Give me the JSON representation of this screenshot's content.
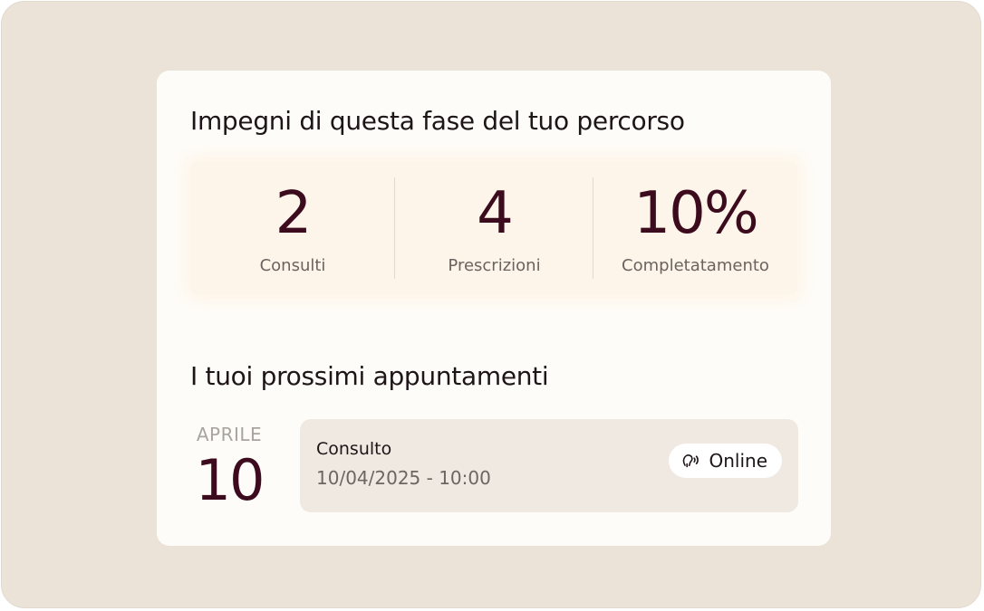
{
  "commitments": {
    "title": "Impegni di questa fase del tuo percorso",
    "stats": [
      {
        "value": "2",
        "label": "Consulti"
      },
      {
        "value": "4",
        "label": "Prescrizioni"
      },
      {
        "value": "10%",
        "label": "Completatamento"
      }
    ]
  },
  "appointments": {
    "title": "I tuoi prossimi appuntamenti",
    "items": [
      {
        "month": "APRILE",
        "day": "10",
        "type": "Consulto",
        "datetime": "10/04/2025 - 10:00",
        "mode_label": "Online",
        "mode_icon": "voice-call-icon"
      }
    ]
  },
  "colors": {
    "background": "#ebe3d8",
    "card": "#fefcf8",
    "stats_panel": "#fdf5e9",
    "accent": "#3c0b1d",
    "appointment_card": "#efe9e2"
  }
}
